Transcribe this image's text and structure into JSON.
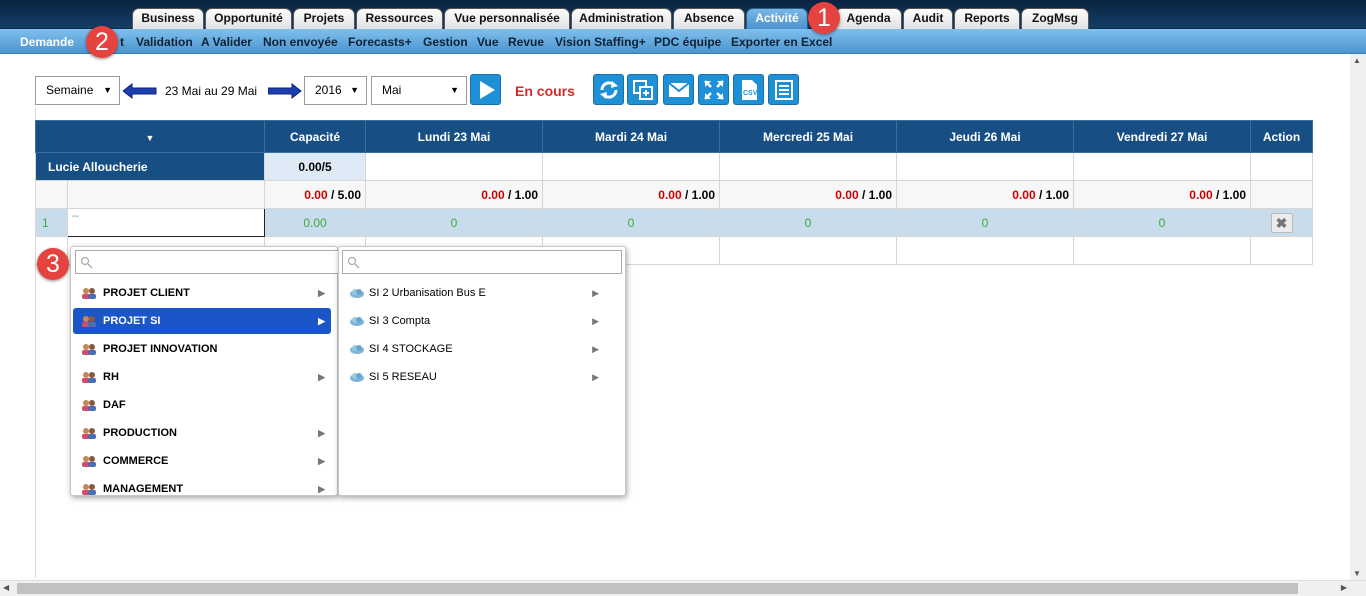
{
  "tabs": [
    "Business",
    "Opportunité",
    "Projets",
    "Ressources",
    "Vue personnalisée",
    "Administration",
    "Absence",
    "Activité",
    "Agenda",
    "Audit",
    "Reports",
    "ZogMsg"
  ],
  "active_tab": "Activité",
  "subnav": [
    "Demande",
    "t",
    "Validation",
    "A Valider",
    "Non envoyée",
    "Forecasts+",
    "Gestion",
    "Vue",
    "Revue",
    "Vision Staffing+",
    "PDC équipe",
    "Exporter en Excel"
  ],
  "badges": [
    "1",
    "2",
    "3"
  ],
  "toolbar": {
    "period": "Semaine",
    "range": "23 Mai au 29 Mai",
    "year": "2016",
    "month": "Mai",
    "status": "En cours",
    "status_color": "#d62b2b"
  },
  "toolbar_icons": [
    "refresh-icon",
    "copy-icon",
    "mail-icon",
    "expand-icon",
    "csv-icon",
    "list-icon"
  ],
  "grid": {
    "headers": [
      "",
      "Capacité",
      "Lundi 23 Mai",
      "Mardi 24 Mai",
      "Mercredi 25 Mai",
      "Jeudi 26 Mai",
      "Vendredi 27 Mai",
      "Action"
    ],
    "person": "Lucie Alloucherie",
    "person_capacity": "0.00/5",
    "totals": [
      {
        "used": "0.00",
        "cap": "5.00"
      },
      {
        "used": "0.00",
        "cap": "1.00"
      },
      {
        "used": "0.00",
        "cap": "1.00"
      },
      {
        "used": "0.00",
        "cap": "1.00"
      },
      {
        "used": "0.00",
        "cap": "1.00"
      },
      {
        "used": "0.00",
        "cap": "1.00"
      }
    ],
    "row_index": "1",
    "row_value": "--",
    "row_capacity": "0.00",
    "row_days": [
      "0",
      "0",
      "0",
      "0",
      "0"
    ]
  },
  "menu": {
    "search_placeholder": "",
    "items": [
      {
        "label": "PROJET CLIENT",
        "submenu": true
      },
      {
        "label": "PROJET SI",
        "submenu": true,
        "active": true
      },
      {
        "label": "PROJET INNOVATION",
        "submenu": false
      },
      {
        "label": "RH",
        "submenu": true
      },
      {
        "label": "DAF",
        "submenu": false
      },
      {
        "label": "PRODUCTION",
        "submenu": true
      },
      {
        "label": "COMMERCE",
        "submenu": true
      },
      {
        "label": "MANAGEMENT",
        "submenu": true
      }
    ]
  },
  "submenu": {
    "search_placeholder": "",
    "items": [
      "SI 2 Urbanisation Bus E",
      "SI 3 Compta",
      "SI 4 STOCKAGE",
      "SI 5 RESEAU"
    ]
  }
}
